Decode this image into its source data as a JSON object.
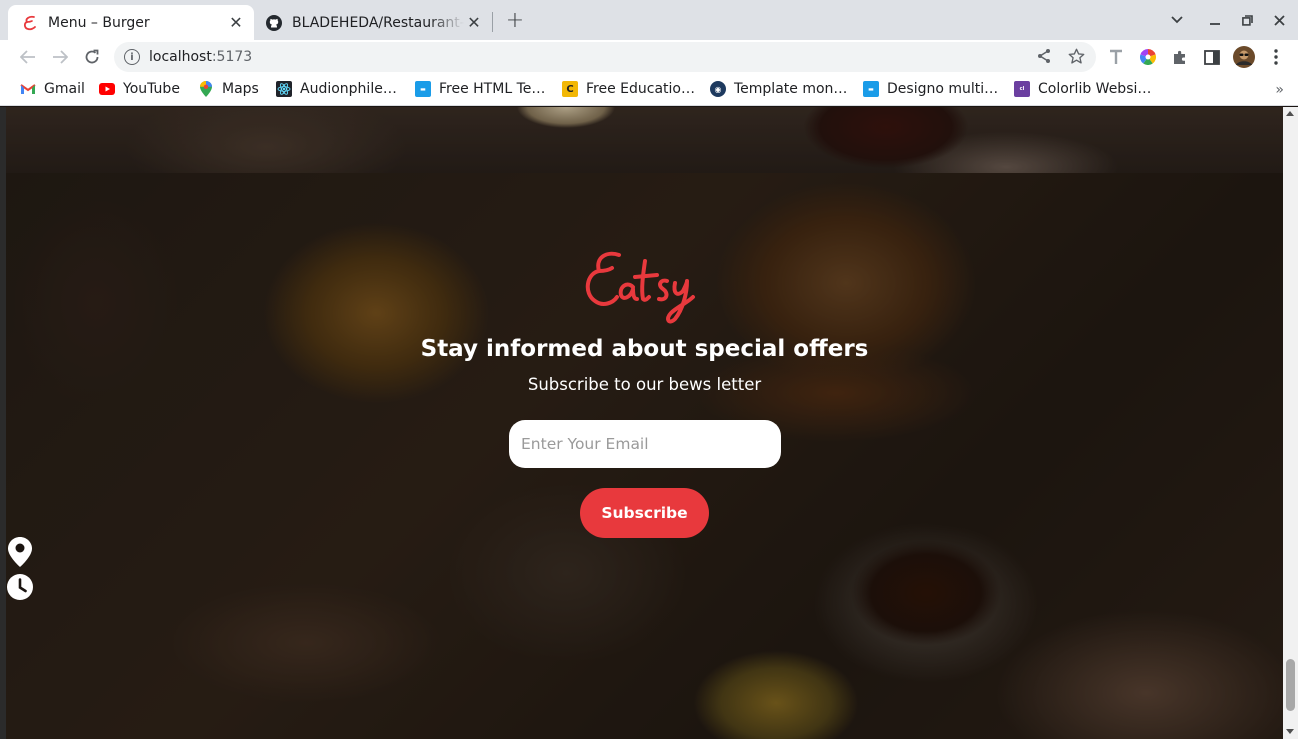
{
  "browser": {
    "tabs": [
      {
        "title": "Menu – Burger",
        "active": true,
        "favicon": "eatsy-logo-icon"
      },
      {
        "title": "BLADEHEDA/Restaurant-",
        "active": false,
        "favicon": "github-icon"
      }
    ],
    "url_host": "localhost",
    "url_port": ":5173",
    "bookmarks": [
      {
        "label": "Gmail",
        "icon": "gmail-icon",
        "color": "#ea4335"
      },
      {
        "label": "YouTube",
        "icon": "youtube-icon",
        "color": "#ff0000"
      },
      {
        "label": "Maps",
        "icon": "maps-icon",
        "color": "#34a853"
      },
      {
        "label": "Audionphile…",
        "icon": "react-icon",
        "color": "#20232a"
      },
      {
        "label": "Free HTML Te…",
        "icon": "site-icon",
        "color": "#1a9ce8"
      },
      {
        "label": "Free Educatio…",
        "icon": "site-icon",
        "color": "#f2b705"
      },
      {
        "label": "Template mon…",
        "icon": "site-icon",
        "color": "#1e3a5f"
      },
      {
        "label": "Designo multi…",
        "icon": "site-icon",
        "color": "#1a9ce8"
      },
      {
        "label": "Colorlib Websi…",
        "icon": "site-icon",
        "color": "#6b3fa0"
      }
    ],
    "bookmarks_overflow": "»"
  },
  "page": {
    "brand": "Eatsy",
    "brand_color": "#e8393d",
    "headline": "Stay informed about special offers",
    "subheadline": "Subscribe to our bews letter",
    "email_placeholder": "Enter Your Email",
    "subscribe_label": "Subscribe",
    "accent": "#e8393d",
    "floating_icons": [
      "location-pin-icon",
      "clock-icon"
    ]
  }
}
